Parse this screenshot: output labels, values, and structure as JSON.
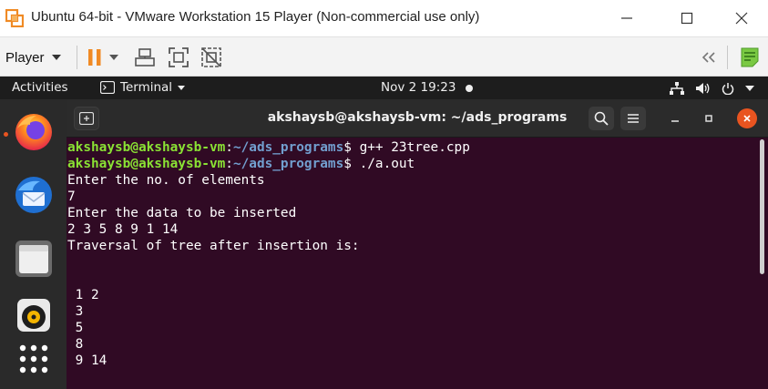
{
  "vmware": {
    "title": "Ubuntu 64-bit - VMware Workstation 15 Player (Non-commercial use only)",
    "player_label": "Player",
    "icons": [
      "vmware-logo-icon",
      "pause-icon",
      "dropdown-caret-icon",
      "send-ctrl-alt-del-icon",
      "fullscreen-icon",
      "unity-icon",
      "collapse-toolbar-icon",
      "notes-icon"
    ],
    "accent": "#f08a24"
  },
  "ubuntu_topbar": {
    "activities": "Activities",
    "app_name": "Terminal",
    "clock": "Nov 2  19:23",
    "tray_icons": [
      "network-icon",
      "volume-icon",
      "power-icon",
      "system-menu-caret-icon"
    ]
  },
  "dock": {
    "items": [
      "Firefox",
      "Thunderbird",
      "Files",
      "Rhythmbox",
      "Show Applications"
    ]
  },
  "terminal": {
    "title": "akshaysb@akshaysb-vm: ~/ads_programs",
    "prompt_user": "akshaysb@akshaysb-vm",
    "prompt_path": "~/ads_programs",
    "colors": {
      "background": "#300a24",
      "user": "#8ae234",
      "path": "#729fcf",
      "close": "#e95420"
    },
    "cmd1": "g++ 23tree.cpp",
    "cmd2": "./a.out",
    "output": {
      "l1": "Enter the no. of elements",
      "l2": "7",
      "l3": "Enter the data to be inserted",
      "l4": "2 3 5 8 9 1 14",
      "l5": "Traversal of tree after insertion is:",
      "l6": "",
      "l7": "",
      "l8": " 1 2",
      "l9": " 3",
      "l10": " 5",
      "l11": " 8",
      "l12": " 9 14"
    }
  }
}
